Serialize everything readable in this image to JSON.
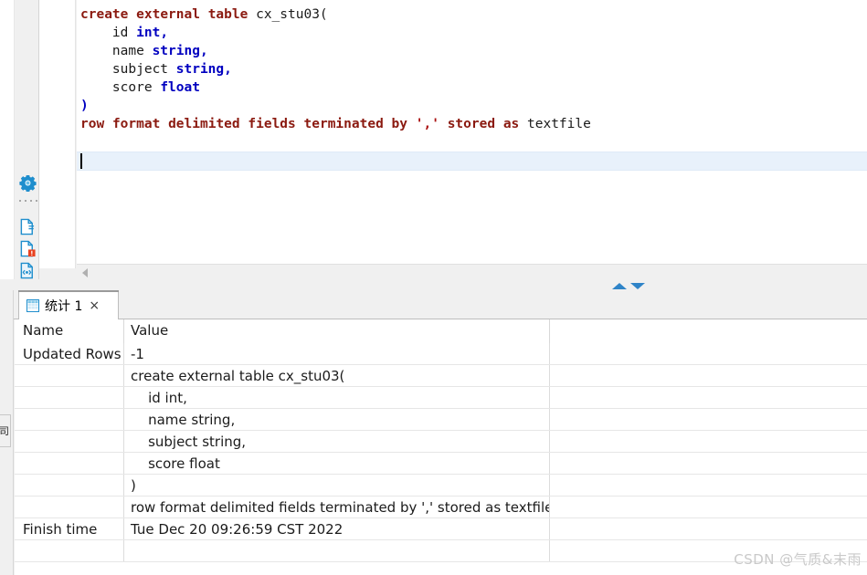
{
  "editor": {
    "language": "hiveql",
    "lines": [
      {
        "indent": 0,
        "tokens": [
          {
            "t": "create",
            "c": "kw-b"
          },
          {
            "t": " ",
            "c": "plain"
          },
          {
            "t": "external",
            "c": "kw-b"
          },
          {
            "t": " ",
            "c": "plain"
          },
          {
            "t": "table",
            "c": "kw-b"
          },
          {
            "t": " ",
            "c": "plain"
          },
          {
            "t": "cx_stu03(",
            "c": "plain"
          }
        ]
      },
      {
        "indent": 1,
        "tokens": [
          {
            "t": "    id ",
            "c": "plain"
          },
          {
            "t": "int",
            "c": "type"
          },
          {
            "t": ",",
            "c": "type"
          }
        ]
      },
      {
        "indent": 1,
        "tokens": [
          {
            "t": "    name ",
            "c": "plain"
          },
          {
            "t": "string",
            "c": "type"
          },
          {
            "t": ",",
            "c": "type"
          }
        ]
      },
      {
        "indent": 1,
        "tokens": [
          {
            "t": "    subject ",
            "c": "plain"
          },
          {
            "t": "string",
            "c": "type"
          },
          {
            "t": ",",
            "c": "type"
          }
        ]
      },
      {
        "indent": 1,
        "tokens": [
          {
            "t": "    score ",
            "c": "plain"
          },
          {
            "t": "float",
            "c": "type"
          }
        ]
      },
      {
        "indent": 0,
        "tokens": [
          {
            "t": ")",
            "c": "type"
          }
        ]
      },
      {
        "indent": 0,
        "tokens": [
          {
            "t": "row",
            "c": "kw-b"
          },
          {
            "t": " ",
            "c": "plain"
          },
          {
            "t": "format",
            "c": "kw-b"
          },
          {
            "t": " ",
            "c": "plain"
          },
          {
            "t": "delimited",
            "c": "kw-b"
          },
          {
            "t": " ",
            "c": "plain"
          },
          {
            "t": "fields",
            "c": "kw-b"
          },
          {
            "t": " ",
            "c": "plain"
          },
          {
            "t": "terminated",
            "c": "kw-b"
          },
          {
            "t": " ",
            "c": "plain"
          },
          {
            "t": "by",
            "c": "kw-b"
          },
          {
            "t": " ",
            "c": "plain"
          },
          {
            "t": "','",
            "c": "str"
          },
          {
            "t": " ",
            "c": "plain"
          },
          {
            "t": "stored",
            "c": "kw-b"
          },
          {
            "t": " ",
            "c": "plain"
          },
          {
            "t": "as",
            "c": "kw-b"
          },
          {
            "t": " ",
            "c": "plain"
          },
          {
            "t": "textfile",
            "c": "plain"
          }
        ]
      },
      {
        "indent": 0,
        "tokens": []
      },
      {
        "indent": 0,
        "tokens": []
      }
    ],
    "caret_line": 8
  },
  "sidebar": {
    "items": [
      {
        "name": "gear-icon",
        "label": "Configure"
      },
      {
        "name": "separator-dots",
        "label": ""
      },
      {
        "name": "document-add-icon",
        "label": "New SQL document"
      },
      {
        "name": "document-error-icon",
        "label": "Document with errors"
      },
      {
        "name": "document-script-icon",
        "label": "Script document"
      }
    ]
  },
  "splitter": {
    "collapse_up_label": "Collapse",
    "collapse_down_label": "Expand"
  },
  "scrollbar": {
    "left_arrow_label": "Scroll left"
  },
  "results": {
    "tab": {
      "icon": "grid-icon",
      "label": "统计 1",
      "close_label": "×"
    },
    "vertical_tab_stub": "司",
    "columns": [
      "Name",
      "Value"
    ],
    "rows": [
      {
        "name": "Updated Rows",
        "value": "-1"
      },
      {
        "name": "",
        "value": "create external table cx_stu03("
      },
      {
        "name": "",
        "value": "    id int,"
      },
      {
        "name": "",
        "value": "    name string,"
      },
      {
        "name": "",
        "value": "    subject string,"
      },
      {
        "name": "",
        "value": "    score float"
      },
      {
        "name": "",
        "value": ")"
      },
      {
        "name": "",
        "value": "row format delimited fields terminated by ',' stored as textfile"
      },
      {
        "name": "Finish time",
        "value": "Tue Dec 20 09:26:59 CST 2022"
      },
      {
        "name": "",
        "value": ""
      }
    ]
  },
  "watermark": {
    "text": "CSDN @气质&末雨"
  },
  "colors": {
    "accent_blue": "#2f84c8",
    "keyword": "#8b1a10",
    "type": "#0000c0",
    "string": "#aa1111",
    "current_line": "#e8f1fb",
    "error_red": "#e8411f"
  }
}
